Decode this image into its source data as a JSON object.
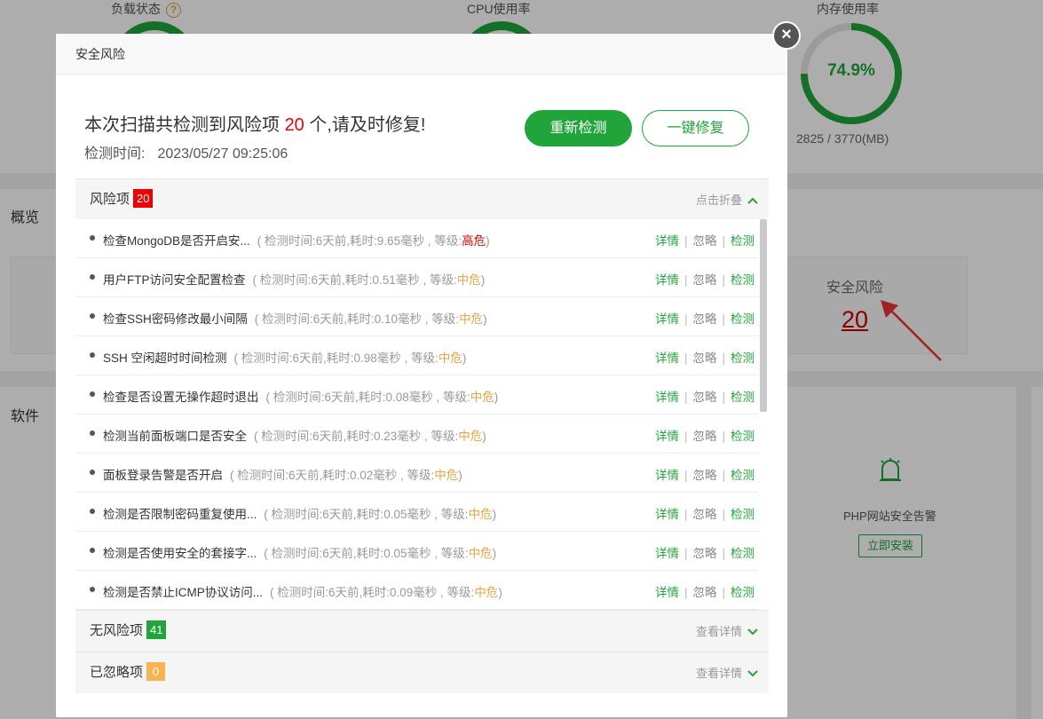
{
  "background": {
    "gauges": [
      {
        "label": "负载状态",
        "has_help": true
      },
      {
        "label": "CPU使用率",
        "has_help": false
      },
      {
        "label": "内存使用率",
        "has_help": false
      }
    ],
    "help_glyph": "?",
    "memory": {
      "percent": "74.9%",
      "detail": "2825 / 3770(MB)",
      "fraction": 0.749
    },
    "sections": {
      "overview": "概览",
      "software": "软件"
    },
    "risk_card": {
      "label": "安全风险",
      "count": "20"
    },
    "php_plugin": {
      "label": "PHP网站安全告警",
      "button": "立即安装"
    }
  },
  "dialog": {
    "title": "安全风险",
    "close_glyph": "×",
    "summary_prefix": "本次扫描共检测到风险项 ",
    "summary_count": "20",
    "summary_suffix": " 个,请及时修复!",
    "scan_time_label": "检测时间:",
    "scan_time": "2023/05/27 09:25:06",
    "rescan_button": "重新检测",
    "fix_all_button": "一键修复",
    "risk_group": {
      "label": "风险项",
      "count": "20",
      "toggle": "点击折叠"
    },
    "safe_group": {
      "label": "无风险项",
      "count": "41",
      "toggle": "查看详情"
    },
    "ignored_group": {
      "label": "已忽略项",
      "count": "0",
      "toggle": "查看详情"
    },
    "actions": {
      "detail": "详情",
      "ignore": "忽略",
      "check": "检测",
      "sep": "|"
    },
    "items": [
      {
        "name": "检查MongoDB是否开启安...",
        "meta_prefix": "( 检测时间:6天前,耗时:9.65毫秒 , 等级:",
        "level": "高危",
        "level_type": "high",
        "meta_suffix": ")"
      },
      {
        "name": "用户FTP访问安全配置检查",
        "meta_prefix": "( 检测时间:6天前,耗时:0.51毫秒 , 等级:",
        "level": "中危",
        "level_type": "mid",
        "meta_suffix": ")"
      },
      {
        "name": "检查SSH密码修改最小间隔",
        "meta_prefix": "( 检测时间:6天前,耗时:0.10毫秒 , 等级:",
        "level": "中危",
        "level_type": "mid",
        "meta_suffix": ")"
      },
      {
        "name": "SSH 空闲超时时间检测",
        "meta_prefix": "( 检测时间:6天前,耗时:0.98毫秒 , 等级:",
        "level": "中危",
        "level_type": "mid",
        "meta_suffix": ")"
      },
      {
        "name": "检查是否设置无操作超时退出",
        "meta_prefix": "( 检测时间:6天前,耗时:0.08毫秒 , 等级:",
        "level": "中危",
        "level_type": "mid",
        "meta_suffix": ")"
      },
      {
        "name": "检测当前面板端口是否安全",
        "meta_prefix": "( 检测时间:6天前,耗时:0.23毫秒 , 等级:",
        "level": "中危",
        "level_type": "mid",
        "meta_suffix": ")"
      },
      {
        "name": "面板登录告警是否开启",
        "meta_prefix": "( 检测时间:6天前,耗时:0.02毫秒 , 等级:",
        "level": "中危",
        "level_type": "mid",
        "meta_suffix": ")"
      },
      {
        "name": "检测是否限制密码重复使用...",
        "meta_prefix": "( 检测时间:6天前,耗时:0.05毫秒 , 等级:",
        "level": "中危",
        "level_type": "mid",
        "meta_suffix": ")"
      },
      {
        "name": "检测是否使用安全的套接字...",
        "meta_prefix": "( 检测时间:6天前,耗时:0.05毫秒 , 等级:",
        "level": "中危",
        "level_type": "mid",
        "meta_suffix": ")"
      },
      {
        "name": "检测是否禁止ICMP协议访问...",
        "meta_prefix": "( 检测时间:6天前,耗时:0.09毫秒 , 等级:",
        "level": "中危",
        "level_type": "mid",
        "meta_suffix": ")"
      }
    ]
  },
  "colors": {
    "accent": "#20a53a",
    "danger": "#e00000",
    "warning": "#e8a33d"
  }
}
